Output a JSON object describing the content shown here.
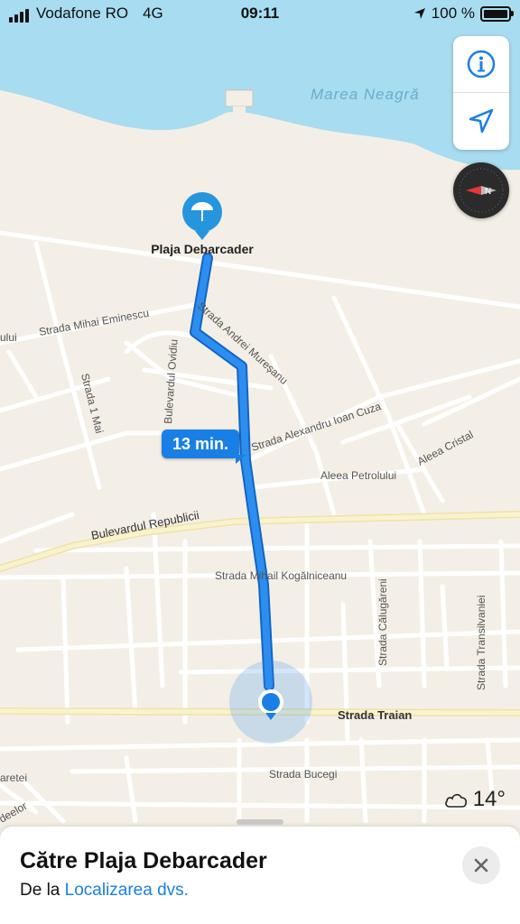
{
  "status_bar": {
    "carrier": "Vodafone RO",
    "network": "4G",
    "time": "09:11",
    "battery": "100 %"
  },
  "map": {
    "sea_label": "Marea Neagră",
    "destination_label": "Plaja Debarcader",
    "destination_icon": "beach-umbrella-icon",
    "route_eta": "13 min.",
    "streets": {
      "eminescu": "Strada Mihai Eminescu",
      "muresanu": "Strada Andrei Mureșanu",
      "ovidiu": "Bulevardul Ovidiu",
      "unu_mai": "Strada 1 Mai",
      "cuza": "Strada Alexandru Ioan Cuza",
      "cristal": "Aleea Cristal",
      "petrolului": "Aleea Petrolului",
      "republicii": "Bulevardul Republicii",
      "kogalniceanu": "Strada Mihail Kogălniceanu",
      "calugareni": "Strada Călugăreni",
      "transilvaniei": "Strada Transilvaniei",
      "traian": "Strada Traian",
      "bucegi": "Strada Bucegi",
      "partial_left": "ului",
      "partial_left2": "aretei",
      "partial_left3": "deelor"
    },
    "colors": {
      "water": "#a8dcf0",
      "land": "#f4efe6",
      "route": "#2c8ef0",
      "major_road": "#f7eec4"
    }
  },
  "controls": {
    "info_icon": "info-icon",
    "locate_icon": "location-arrow-icon",
    "compass_icon": "compass-icon"
  },
  "weather": {
    "icon": "cloud-icon",
    "temperature": "14°"
  },
  "sheet": {
    "title": "Către Plaja Debarcader",
    "from_prefix": "De la",
    "from_link": "Localizarea dvs.",
    "close_icon": "close-icon"
  }
}
